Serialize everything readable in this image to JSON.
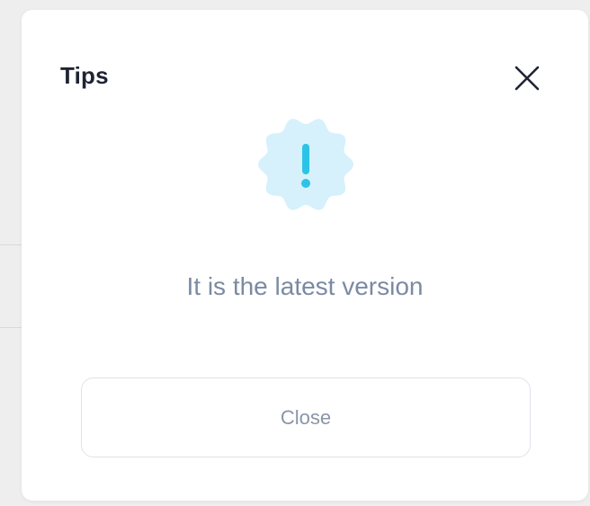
{
  "dialog": {
    "title": "Tips",
    "message": "It is the latest version",
    "close_button_label": "Close"
  },
  "icons": {
    "close": "close-icon",
    "status": "exclamation-badge-icon"
  },
  "colors": {
    "badge_fill": "#d6f1fb",
    "badge_mark": "#2cc3e8",
    "title_text": "#1f2433",
    "message_text": "#7b8aa3",
    "button_border": "#dfe3ea",
    "button_text": "#8b95a8"
  }
}
